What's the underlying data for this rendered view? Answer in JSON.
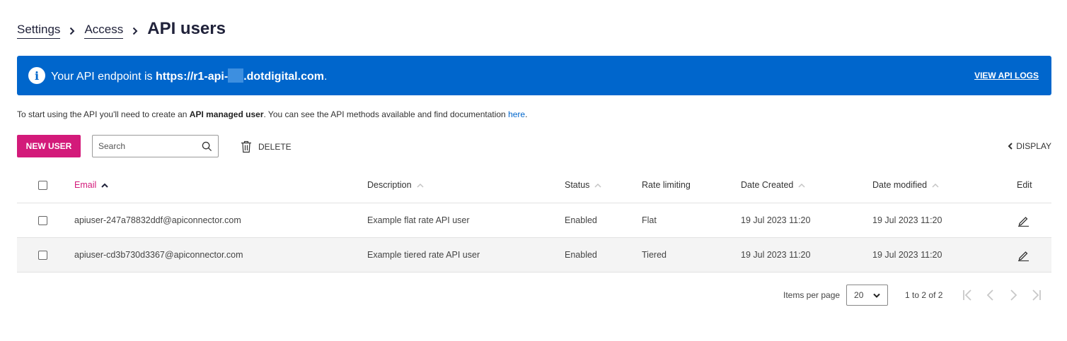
{
  "breadcrumb": {
    "items": [
      "Settings",
      "Access"
    ],
    "current": "API users"
  },
  "banner": {
    "prefix": "Your API endpoint is ",
    "endpoint_start": "https://r1-api-",
    "endpoint_end": ".dotdigital.com",
    "suffix": ".",
    "link_label": "VIEW API LOGS",
    "color": "#0066cc"
  },
  "intro": {
    "part1": "To start using the API you'll need to create an ",
    "bold": "API managed user",
    "part2": ". You can see the API methods available and find documentation ",
    "link": "here",
    "part3": "."
  },
  "toolbar": {
    "new_user_label": "NEW USER",
    "search_placeholder": "Search",
    "delete_label": "DELETE",
    "display_label": "DISPLAY",
    "accent": "#d31a7a"
  },
  "table": {
    "headers": {
      "email": "Email",
      "description": "Description",
      "status": "Status",
      "rate_limiting": "Rate limiting",
      "date_created": "Date Created",
      "date_modified": "Date modified",
      "edit": "Edit"
    },
    "rows": [
      {
        "email": "apiuser-247a78832ddf@apiconnector.com",
        "description": "Example flat rate API user",
        "status": "Enabled",
        "rate_limiting": "Flat",
        "date_created": "19 Jul 2023 11:20",
        "date_modified": "19 Jul 2023 11:20"
      },
      {
        "email": "apiuser-cd3b730d3367@apiconnector.com",
        "description": "Example tiered rate API user",
        "status": "Enabled",
        "rate_limiting": "Tiered",
        "date_created": "19 Jul 2023 11:20",
        "date_modified": "19 Jul 2023 11:20"
      }
    ]
  },
  "pager": {
    "items_per_page_label": "Items per page",
    "items_per_page_value": "20",
    "range": "1 to 2 of 2"
  }
}
